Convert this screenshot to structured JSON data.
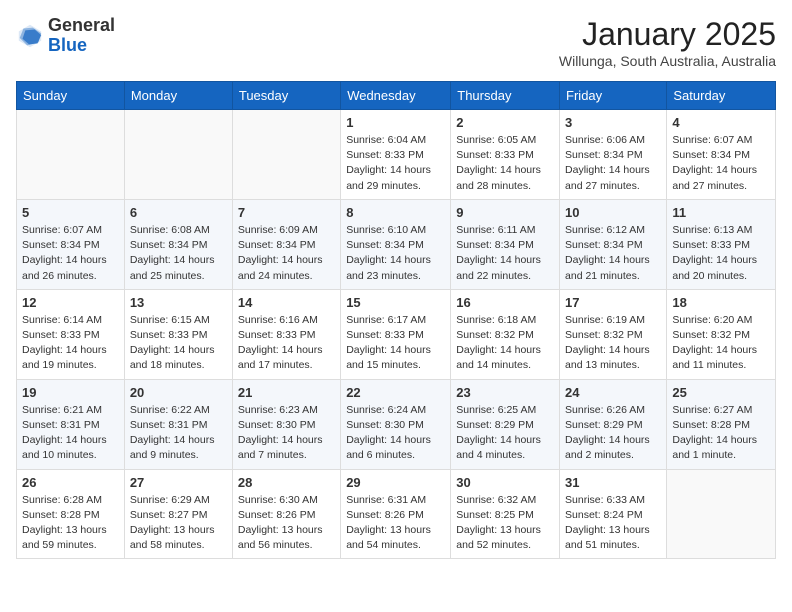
{
  "header": {
    "logo_general": "General",
    "logo_blue": "Blue",
    "month_title": "January 2025",
    "location": "Willunga, South Australia, Australia"
  },
  "weekdays": [
    "Sunday",
    "Monday",
    "Tuesday",
    "Wednesday",
    "Thursday",
    "Friday",
    "Saturday"
  ],
  "weeks": [
    [
      {
        "day": "",
        "sunrise": "",
        "sunset": "",
        "daylight": ""
      },
      {
        "day": "",
        "sunrise": "",
        "sunset": "",
        "daylight": ""
      },
      {
        "day": "",
        "sunrise": "",
        "sunset": "",
        "daylight": ""
      },
      {
        "day": "1",
        "sunrise": "Sunrise: 6:04 AM",
        "sunset": "Sunset: 8:33 PM",
        "daylight": "Daylight: 14 hours and 29 minutes."
      },
      {
        "day": "2",
        "sunrise": "Sunrise: 6:05 AM",
        "sunset": "Sunset: 8:33 PM",
        "daylight": "Daylight: 14 hours and 28 minutes."
      },
      {
        "day": "3",
        "sunrise": "Sunrise: 6:06 AM",
        "sunset": "Sunset: 8:34 PM",
        "daylight": "Daylight: 14 hours and 27 minutes."
      },
      {
        "day": "4",
        "sunrise": "Sunrise: 6:07 AM",
        "sunset": "Sunset: 8:34 PM",
        "daylight": "Daylight: 14 hours and 27 minutes."
      }
    ],
    [
      {
        "day": "5",
        "sunrise": "Sunrise: 6:07 AM",
        "sunset": "Sunset: 8:34 PM",
        "daylight": "Daylight: 14 hours and 26 minutes."
      },
      {
        "day": "6",
        "sunrise": "Sunrise: 6:08 AM",
        "sunset": "Sunset: 8:34 PM",
        "daylight": "Daylight: 14 hours and 25 minutes."
      },
      {
        "day": "7",
        "sunrise": "Sunrise: 6:09 AM",
        "sunset": "Sunset: 8:34 PM",
        "daylight": "Daylight: 14 hours and 24 minutes."
      },
      {
        "day": "8",
        "sunrise": "Sunrise: 6:10 AM",
        "sunset": "Sunset: 8:34 PM",
        "daylight": "Daylight: 14 hours and 23 minutes."
      },
      {
        "day": "9",
        "sunrise": "Sunrise: 6:11 AM",
        "sunset": "Sunset: 8:34 PM",
        "daylight": "Daylight: 14 hours and 22 minutes."
      },
      {
        "day": "10",
        "sunrise": "Sunrise: 6:12 AM",
        "sunset": "Sunset: 8:34 PM",
        "daylight": "Daylight: 14 hours and 21 minutes."
      },
      {
        "day": "11",
        "sunrise": "Sunrise: 6:13 AM",
        "sunset": "Sunset: 8:33 PM",
        "daylight": "Daylight: 14 hours and 20 minutes."
      }
    ],
    [
      {
        "day": "12",
        "sunrise": "Sunrise: 6:14 AM",
        "sunset": "Sunset: 8:33 PM",
        "daylight": "Daylight: 14 hours and 19 minutes."
      },
      {
        "day": "13",
        "sunrise": "Sunrise: 6:15 AM",
        "sunset": "Sunset: 8:33 PM",
        "daylight": "Daylight: 14 hours and 18 minutes."
      },
      {
        "day": "14",
        "sunrise": "Sunrise: 6:16 AM",
        "sunset": "Sunset: 8:33 PM",
        "daylight": "Daylight: 14 hours and 17 minutes."
      },
      {
        "day": "15",
        "sunrise": "Sunrise: 6:17 AM",
        "sunset": "Sunset: 8:33 PM",
        "daylight": "Daylight: 14 hours and 15 minutes."
      },
      {
        "day": "16",
        "sunrise": "Sunrise: 6:18 AM",
        "sunset": "Sunset: 8:32 PM",
        "daylight": "Daylight: 14 hours and 14 minutes."
      },
      {
        "day": "17",
        "sunrise": "Sunrise: 6:19 AM",
        "sunset": "Sunset: 8:32 PM",
        "daylight": "Daylight: 14 hours and 13 minutes."
      },
      {
        "day": "18",
        "sunrise": "Sunrise: 6:20 AM",
        "sunset": "Sunset: 8:32 PM",
        "daylight": "Daylight: 14 hours and 11 minutes."
      }
    ],
    [
      {
        "day": "19",
        "sunrise": "Sunrise: 6:21 AM",
        "sunset": "Sunset: 8:31 PM",
        "daylight": "Daylight: 14 hours and 10 minutes."
      },
      {
        "day": "20",
        "sunrise": "Sunrise: 6:22 AM",
        "sunset": "Sunset: 8:31 PM",
        "daylight": "Daylight: 14 hours and 9 minutes."
      },
      {
        "day": "21",
        "sunrise": "Sunrise: 6:23 AM",
        "sunset": "Sunset: 8:30 PM",
        "daylight": "Daylight: 14 hours and 7 minutes."
      },
      {
        "day": "22",
        "sunrise": "Sunrise: 6:24 AM",
        "sunset": "Sunset: 8:30 PM",
        "daylight": "Daylight: 14 hours and 6 minutes."
      },
      {
        "day": "23",
        "sunrise": "Sunrise: 6:25 AM",
        "sunset": "Sunset: 8:29 PM",
        "daylight": "Daylight: 14 hours and 4 minutes."
      },
      {
        "day": "24",
        "sunrise": "Sunrise: 6:26 AM",
        "sunset": "Sunset: 8:29 PM",
        "daylight": "Daylight: 14 hours and 2 minutes."
      },
      {
        "day": "25",
        "sunrise": "Sunrise: 6:27 AM",
        "sunset": "Sunset: 8:28 PM",
        "daylight": "Daylight: 14 hours and 1 minute."
      }
    ],
    [
      {
        "day": "26",
        "sunrise": "Sunrise: 6:28 AM",
        "sunset": "Sunset: 8:28 PM",
        "daylight": "Daylight: 13 hours and 59 minutes."
      },
      {
        "day": "27",
        "sunrise": "Sunrise: 6:29 AM",
        "sunset": "Sunset: 8:27 PM",
        "daylight": "Daylight: 13 hours and 58 minutes."
      },
      {
        "day": "28",
        "sunrise": "Sunrise: 6:30 AM",
        "sunset": "Sunset: 8:26 PM",
        "daylight": "Daylight: 13 hours and 56 minutes."
      },
      {
        "day": "29",
        "sunrise": "Sunrise: 6:31 AM",
        "sunset": "Sunset: 8:26 PM",
        "daylight": "Daylight: 13 hours and 54 minutes."
      },
      {
        "day": "30",
        "sunrise": "Sunrise: 6:32 AM",
        "sunset": "Sunset: 8:25 PM",
        "daylight": "Daylight: 13 hours and 52 minutes."
      },
      {
        "day": "31",
        "sunrise": "Sunrise: 6:33 AM",
        "sunset": "Sunset: 8:24 PM",
        "daylight": "Daylight: 13 hours and 51 minutes."
      },
      {
        "day": "",
        "sunrise": "",
        "sunset": "",
        "daylight": ""
      }
    ]
  ]
}
